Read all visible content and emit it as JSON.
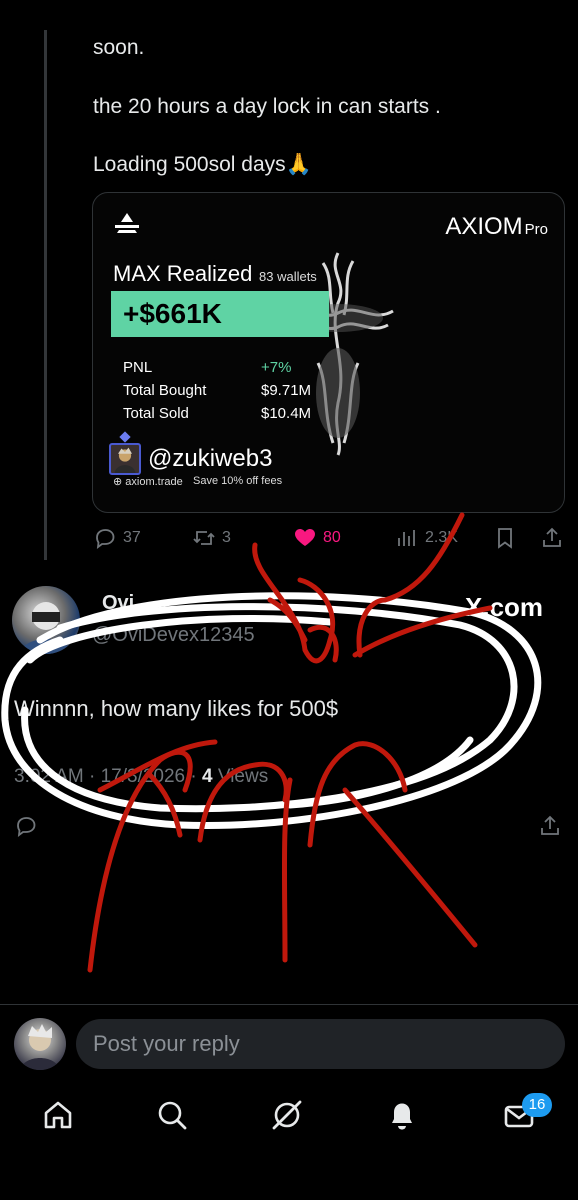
{
  "post": {
    "line1": "soon.",
    "line2": "the 20 hours a day lock in can starts .",
    "line3": "Loading 500sol days🙏"
  },
  "card": {
    "brand": "AXIOM",
    "brand_suffix": "Pro",
    "title": "MAX Realized",
    "wallets": "83 wallets",
    "pnl_value": "+$661K",
    "stats": [
      {
        "label": "PNL",
        "value": "+7%"
      },
      {
        "label": "Total Bought",
        "value": "$9.71M"
      },
      {
        "label": "Total Sold",
        "value": "$10.4M"
      }
    ],
    "handle": "@zukiweb3",
    "site": "axiom.trade",
    "promo": "Save 10% off fees",
    "colors": {
      "accent_green": "#5fd3a4"
    }
  },
  "actions": {
    "replies": "37",
    "reposts": "3",
    "likes": "80",
    "views": "2.3K"
  },
  "reply_post": {
    "name": "Ovi",
    "handle": "@OviDevex12345",
    "watermark": "X.com",
    "text": "Winnnn, how many likes for 500$",
    "time": "3:02 AM · 17/3/2026 · ",
    "views_count": "4",
    "views_label": " Views"
  },
  "composer": {
    "placeholder": "Post your reply"
  },
  "nav": {
    "badge": "16",
    "colors": {
      "badge": "#1d9bf0",
      "like": "#f91880"
    }
  }
}
